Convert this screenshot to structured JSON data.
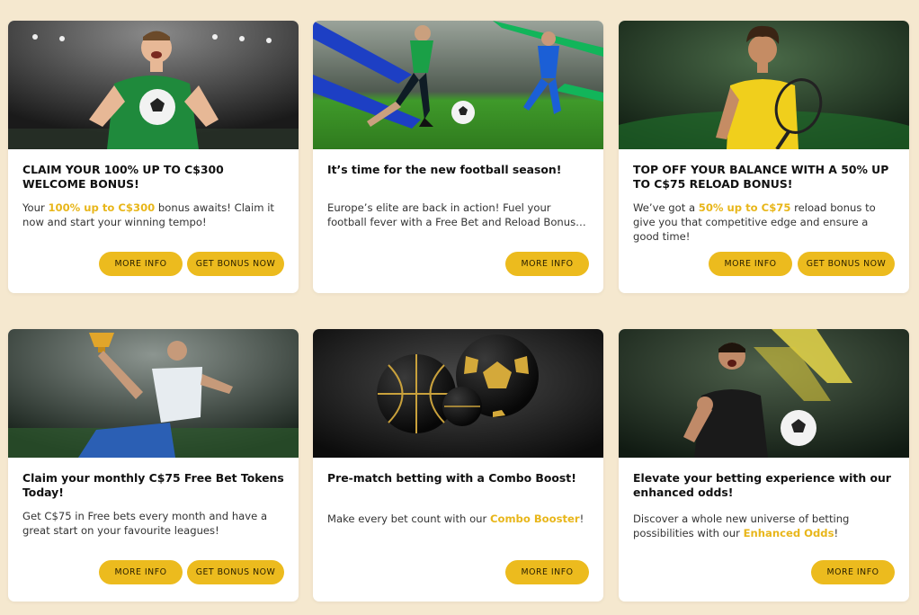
{
  "colors": {
    "background": "#f5e8cf",
    "card": "#ffffff",
    "accent": "#ecbb1e",
    "highlight_text": "#e8b61a"
  },
  "cards": [
    {
      "image": "footballer-holding-ball-stadium",
      "title": "CLAIM YOUR 100% UP TO C$300 WELCOME BONUS!",
      "desc_pre": "Your ",
      "desc_hl": "100% up to C$300",
      "desc_post": " bonus awaits! Claim it now and start your winning tempo!",
      "more_info": "MORE INFO",
      "get_bonus": "GET BONUS NOW"
    },
    {
      "image": "two-footballers-running-pitch",
      "title": "It’s time for the new football season!",
      "desc": "Europe’s elite are back in action! Fuel your football fever with a Free Bet and Reload Bonus that covers it all!",
      "more_info": "MORE INFO"
    },
    {
      "image": "tennis-player-yellow-shirt",
      "title": "TOP OFF YOUR BALANCE WITH A 50% UP TO C$75 RELOAD BONUS!",
      "desc_pre": "We’ve got a ",
      "desc_hl": "50% up to C$75",
      "desc_post": " reload bonus to give you that competitive edge and ensure a good time!",
      "more_info": "MORE INFO",
      "get_bonus": "GET BONUS NOW"
    },
    {
      "image": "athlete-holding-trophy",
      "title": "Claim your monthly C$75 Free Bet Tokens Today!",
      "desc": "Get C$75 in Free bets every month and have a great start on your favourite leagues!",
      "more_info": "MORE INFO",
      "get_bonus": "GET BONUS NOW"
    },
    {
      "image": "black-gold-balls",
      "title": "Pre-match betting with a Combo Boost!",
      "desc_pre": "Make every bet count with our ",
      "desc_hl": "Combo Booster",
      "desc_post": "!",
      "more_info": "MORE INFO"
    },
    {
      "image": "footballer-celebrating-arrow",
      "title": "Elevate your betting experience with our enhanced odds!",
      "desc_pre": "Discover a whole new universe of betting possibilities with our ",
      "desc_hl": "Enhanced Odds",
      "desc_post": "!",
      "more_info": "MORE INFO"
    }
  ]
}
